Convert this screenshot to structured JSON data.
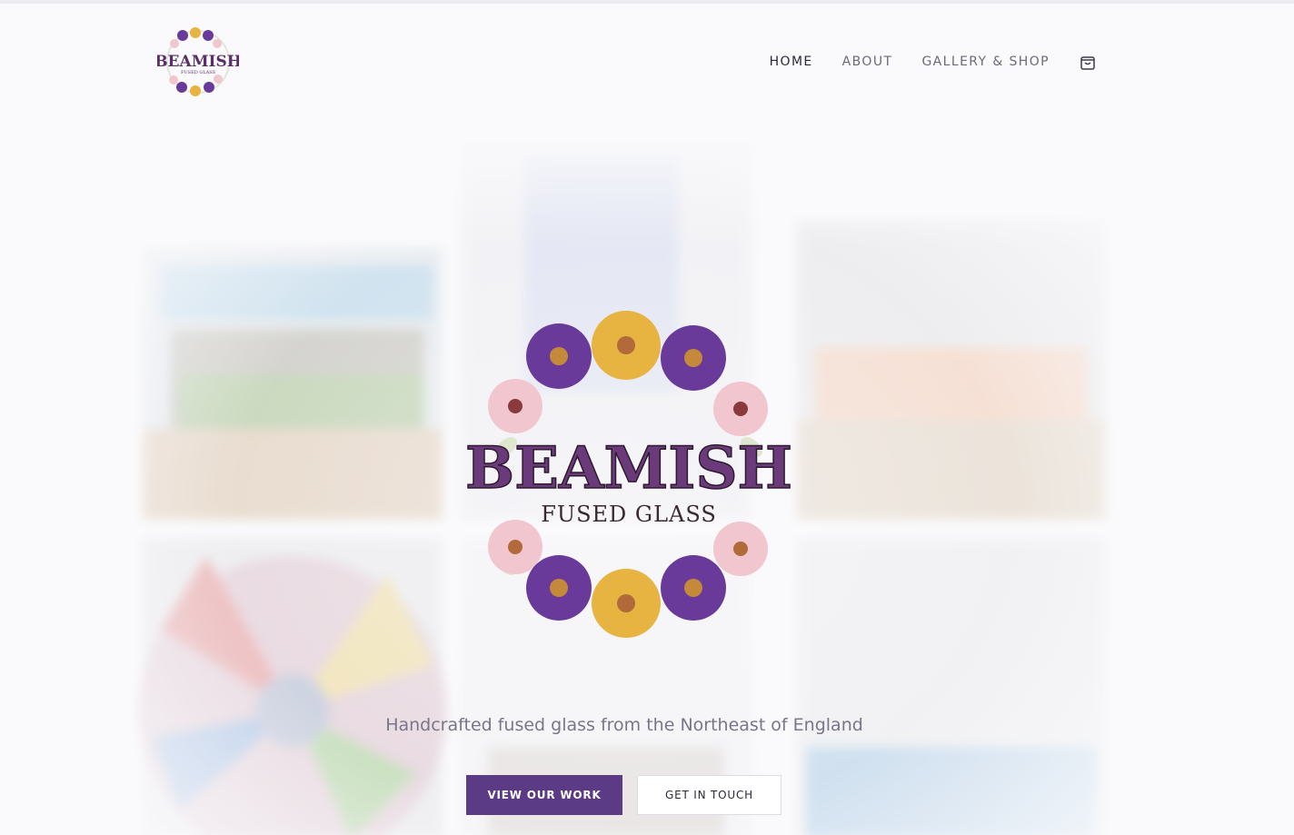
{
  "brand": {
    "name": "BEAMISH",
    "subtitle": "FUSED GLASS"
  },
  "nav": {
    "items": [
      {
        "label": "HOME",
        "active": true
      },
      {
        "label": "ABOUT",
        "active": false
      },
      {
        "label": "GALLERY & SHOP",
        "active": false
      }
    ],
    "cart_icon": "shopping-bag-icon"
  },
  "hero": {
    "tagline": "Handcrafted fused glass from the Northeast of England",
    "primary_button": "VIEW OUR WORK",
    "secondary_button": "GET IN TOUCH"
  },
  "colors": {
    "accent": "#5b3a86",
    "text": "#2b2a3a",
    "muted": "#77768a",
    "flower_purple": "#6a3a9a",
    "flower_yellow": "#e7b341",
    "flower_pink": "#f1c6cf"
  }
}
